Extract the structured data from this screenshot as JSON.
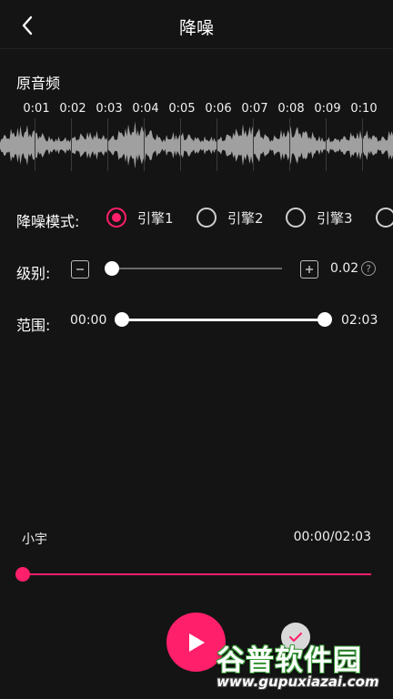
{
  "header": {
    "title": "降噪"
  },
  "original_audio": {
    "label": "原音频",
    "time_ticks": [
      "0:01",
      "0:02",
      "0:03",
      "0:04",
      "0:05",
      "0:06",
      "0:07",
      "0:08",
      "0:09",
      "0:10"
    ]
  },
  "noise_mode": {
    "label": "降噪模式:",
    "options": [
      "引擎1",
      "引擎2",
      "引擎3",
      ""
    ],
    "selected": "引擎1"
  },
  "level": {
    "label": "级别:",
    "minus_icon": "minus-icon",
    "plus_icon": "plus-icon",
    "value": "0.02",
    "help_icon": "question-icon",
    "help_glyph": "?",
    "slider_fraction": 0.0
  },
  "range": {
    "label": "范围:",
    "start": "00:00",
    "end": "02:03"
  },
  "player": {
    "track_name": "小宇",
    "time": "00:00/02:03",
    "progress_fraction": 0.0
  },
  "watermark": {
    "name": "谷普软件园",
    "url": "www.gupuxiazai.com"
  },
  "colors": {
    "accent": "#ff1f6b",
    "background": "#141414",
    "waveform": "#a0a0a0"
  }
}
